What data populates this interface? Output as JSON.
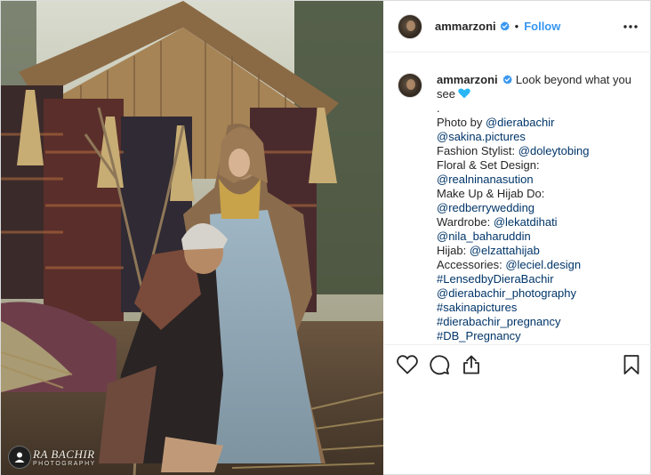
{
  "photo": {
    "watermark_main": "RA BACHIR",
    "watermark_sub": "PHOTOGRAPHY",
    "user_tag_icon": "user-tag-icon"
  },
  "header": {
    "username": "ammarzoni",
    "verified_icon": "verified-badge-icon",
    "separator": "•",
    "follow_label": "Follow",
    "more_icon": "more-options-icon"
  },
  "caption": {
    "username": "ammarzoni",
    "lines": [
      "Look beyond what you see",
      ".",
      "Photo by @dierabachir",
      "@sakina.pictures",
      "Fashion Stylist: @doleytobing",
      "Floral & Set Design:",
      "@realninanasution",
      "Make Up & Hijab Do:",
      "@redberrywedding",
      "Wardrobe: @lekatdihati",
      "@nila_baharuddin",
      "Hijab: @elzattahijab",
      "Accessories: @leciel.design",
      "#LensedbyDieraBachir",
      "@dierabachir_photography",
      "#sakinapictures",
      "#dierabachir_pregnancy",
      "#DB_Pregnancy"
    ],
    "first_line_part1": "Look beyond what you",
    "first_line_part2": "see",
    "emoji": "blue-heart-emoji",
    "photo_by_prefix": "Photo by ",
    "photo_by_handle": "@dierabachir",
    "sakina": "@sakina.pictures",
    "stylist_prefix": "Fashion Stylist: ",
    "stylist_handle": "@doleytobing",
    "floral_label": "Floral & Set Design:",
    "floral_handle": "@realninanasution",
    "makeup_label": "Make Up & Hijab Do:",
    "makeup_handle": "@redberrywedding",
    "wardrobe_prefix": "Wardrobe: ",
    "wardrobe_handle": "@lekatdihati",
    "nila": "@nila_baharuddin",
    "hijab_prefix": "Hijab: ",
    "hijab_handle": "@elzattahijab",
    "acc_prefix": "Accessories: ",
    "acc_handle": "@leciel.design",
    "tag1": "#LensedbyDieraBachir",
    "tag2": "@dierabachir_photography",
    "tag3": "#sakinapictures",
    "tag4": "#dierabachir_pregnancy",
    "tag5": "#DB_Pregnancy",
    "dot_line": "."
  },
  "actions": {
    "like_icon": "heart-outline-icon",
    "comment_icon": "comment-bubble-icon",
    "share_icon": "share-upload-icon",
    "save_icon": "bookmark-icon"
  },
  "colors": {
    "link": "#003569",
    "follow": "#3897f0",
    "verified": "#3897f0",
    "text": "#262626",
    "border": "#dbdbdb"
  }
}
